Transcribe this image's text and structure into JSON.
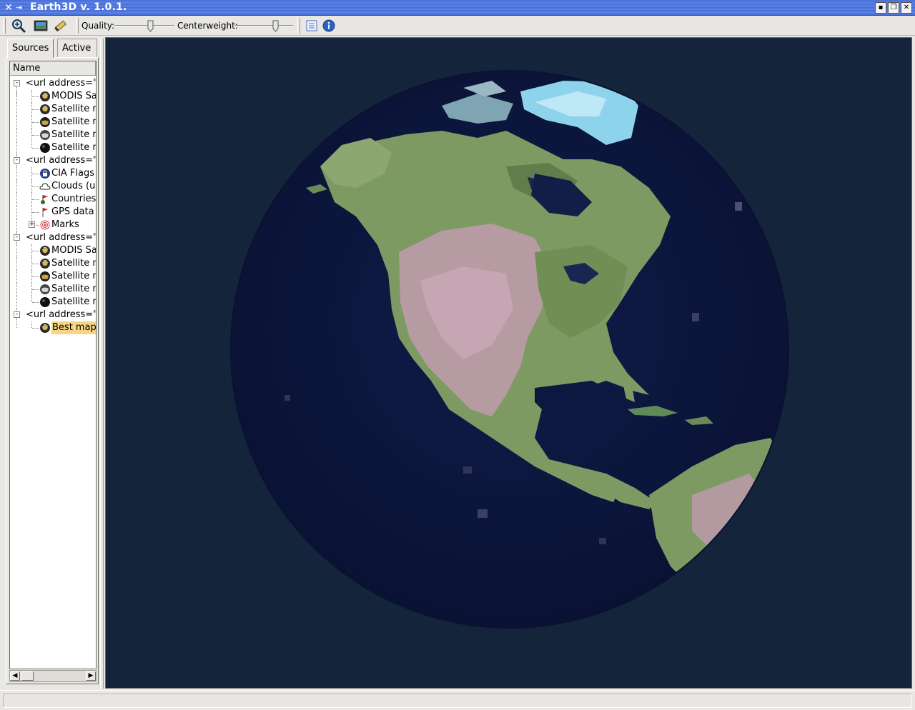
{
  "window": {
    "title": "Earth3D v. 1.0.1.",
    "icon": "x-app-icon"
  },
  "toolbar": {
    "quality_label": "Quality:",
    "quality_value": 0.6,
    "centerweight_label": "Centerweight:",
    "centerweight_value": 0.7,
    "icons": [
      "zoom-icon",
      "screenshot-icon",
      "marker-icon",
      "list-icon",
      "info-icon"
    ]
  },
  "sidebar": {
    "tabs": [
      {
        "label": "Sources"
      },
      {
        "label": "Active"
      }
    ],
    "column_header": "Name",
    "tree": [
      {
        "label": "<url address=\"ht",
        "level": 0,
        "expander": "-",
        "icon": ""
      },
      {
        "label": "MODIS Sa",
        "level": 1,
        "icon": "globe-icon"
      },
      {
        "label": "Satellite m",
        "level": 1,
        "icon": "globe-icon"
      },
      {
        "label": "Satellite m",
        "level": 1,
        "icon": "globe-dark-icon"
      },
      {
        "label": "Satellite m",
        "level": 1,
        "icon": "globe-gray-icon"
      },
      {
        "label": "Satellite m",
        "level": 1,
        "icon": "globe-black-icon"
      },
      {
        "label": "<url address=\"ht",
        "level": 0,
        "expander": "-",
        "icon": ""
      },
      {
        "label": "CIA Flags",
        "level": 1,
        "icon": "lock-badge-icon"
      },
      {
        "label": "Clouds (up",
        "level": 1,
        "icon": "cloud-icon"
      },
      {
        "label": "Countries",
        "level": 1,
        "icon": "flag-icon"
      },
      {
        "label": "GPS data",
        "level": 1,
        "icon": "red-flag-icon"
      },
      {
        "label": "Marks",
        "level": 1,
        "expander": "+",
        "icon": "target-icon"
      },
      {
        "label": "<url address=\"ht",
        "level": 0,
        "expander": "-",
        "icon": ""
      },
      {
        "label": "MODIS Sa",
        "level": 1,
        "icon": "globe-icon"
      },
      {
        "label": "Satellite m",
        "level": 1,
        "icon": "globe-icon"
      },
      {
        "label": "Satellite m",
        "level": 1,
        "icon": "globe-dark-icon"
      },
      {
        "label": "Satellite m",
        "level": 1,
        "icon": "globe-gray-icon"
      },
      {
        "label": "Satellite m",
        "level": 1,
        "icon": "globe-black-icon"
      },
      {
        "label": "<url address=\"ht",
        "level": 0,
        "expander": "-",
        "icon": ""
      },
      {
        "label": "Best map:",
        "level": 1,
        "icon": "globe-icon",
        "selected": true
      }
    ]
  },
  "colors": {
    "view_background": "#14243a",
    "ocean": "#0c1840",
    "selection": "#f8d584",
    "title_bar": "#4a6fd6"
  }
}
